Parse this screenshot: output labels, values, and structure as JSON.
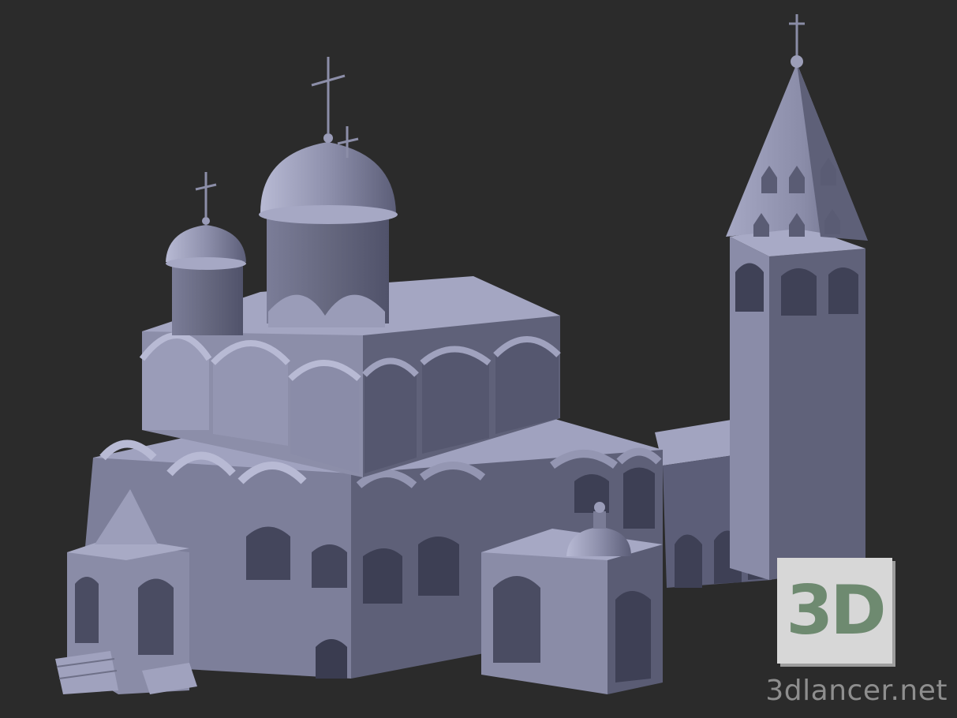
{
  "image": {
    "subject": "cathedral-3d-model",
    "background_color": "#2b2b2b",
    "model_colors": {
      "light": "#aeb0cc",
      "mid": "#8c8eaa",
      "dark": "#5d5f7a",
      "darkest": "#44465c",
      "roof": "#9a9cb9"
    }
  },
  "badge": {
    "text": "3D",
    "text_color": "#6e8a70",
    "background": "#d7d7d7"
  },
  "watermark": {
    "text": "3dlancer.net"
  }
}
